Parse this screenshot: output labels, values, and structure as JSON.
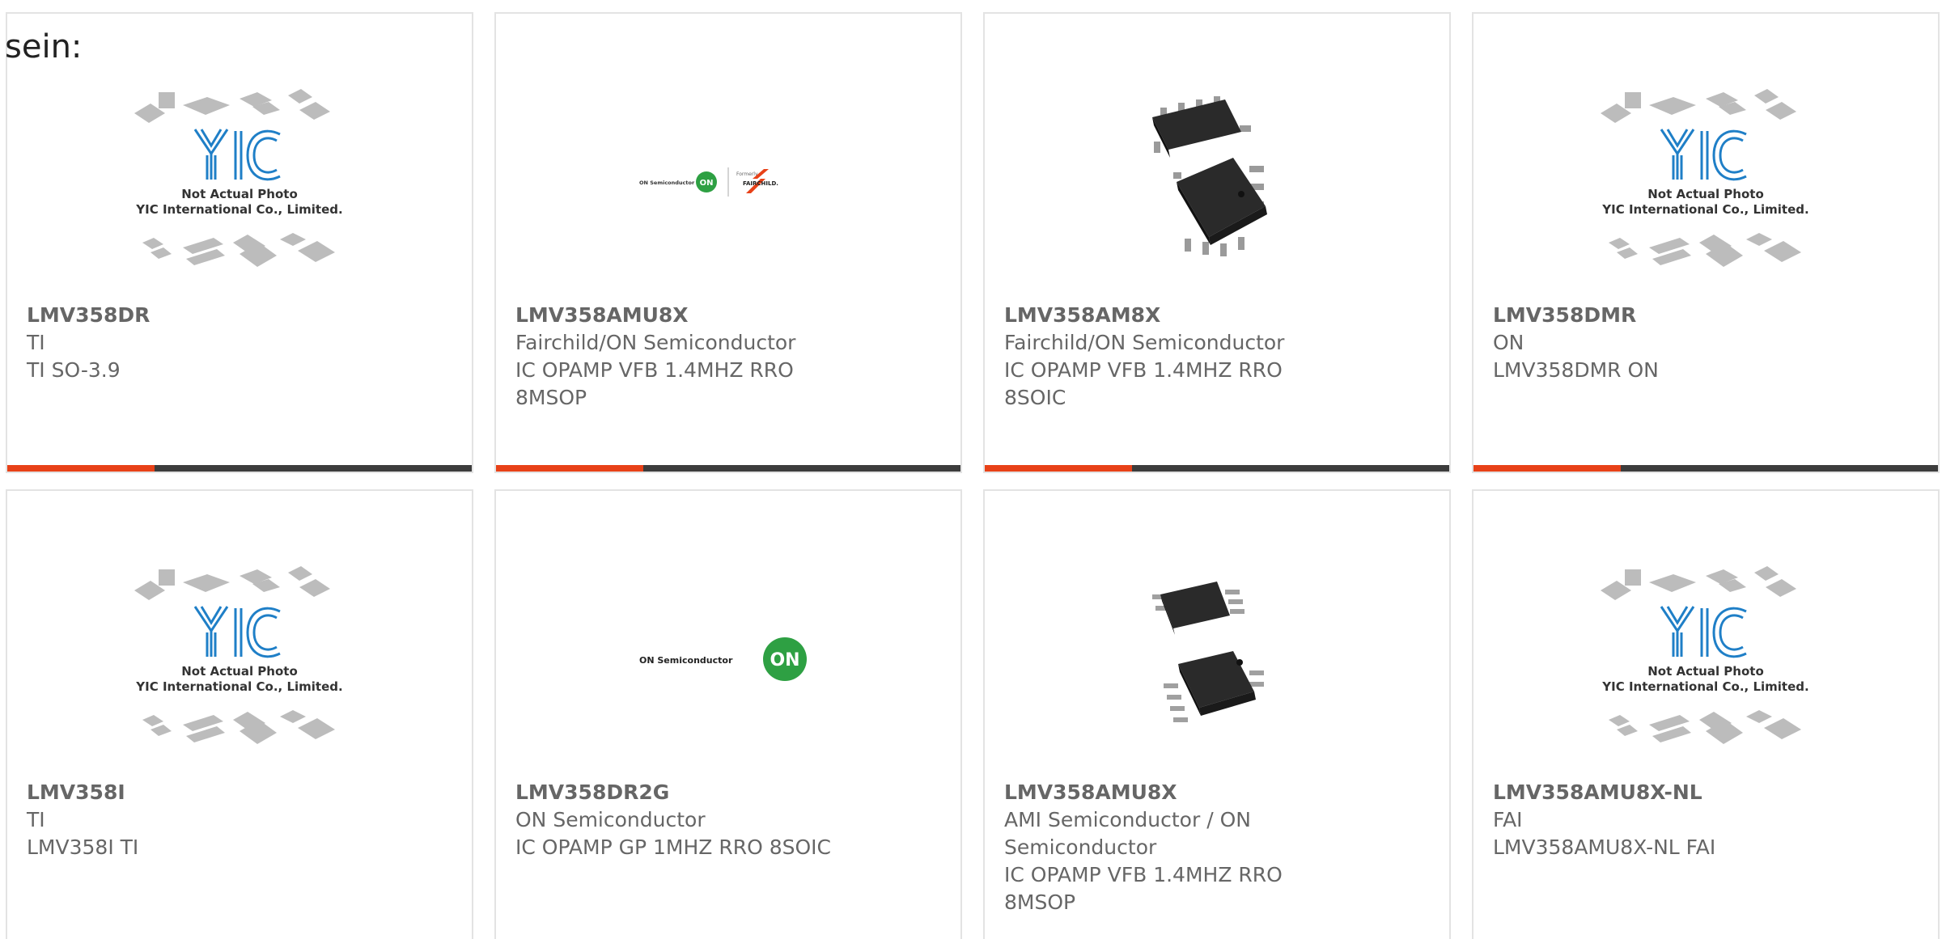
{
  "intro": "sein:",
  "placeholder": {
    "line1": "Not Actual Photo",
    "line2": "YIC International Co., Limited."
  },
  "logos": {
    "on_semi_text": "ON Semiconductor",
    "on_badge": "ON",
    "formerly": "Formerly",
    "fairchild": "FAIRCHILD."
  },
  "colors": {
    "accent": "#e84118",
    "bar": "#3c3c3c",
    "text": "#666666",
    "on_green": "#2ea043",
    "yic_blue": "#1f7fc7"
  },
  "products": [
    {
      "part": "LMV358DR",
      "manufacturer": "TI",
      "description": "TI SO-3.9",
      "image": "yic-placeholder"
    },
    {
      "part": "LMV358AMU8X",
      "manufacturer": "Fairchild/ON Semiconductor",
      "description": "IC OPAMP VFB 1.4MHZ RRO 8MSOP",
      "image": "on-fairchild-logo"
    },
    {
      "part": "LMV358AM8X",
      "manufacturer": "Fairchild/ON Semiconductor",
      "description": "IC OPAMP VFB 1.4MHZ RRO 8SOIC",
      "image": "soic-chip"
    },
    {
      "part": "LMV358DMR",
      "manufacturer": "ON",
      "description": "LMV358DMR ON",
      "image": "yic-placeholder"
    },
    {
      "part": "LMV358I",
      "manufacturer": "TI",
      "description": "LMV358I TI",
      "image": "yic-placeholder"
    },
    {
      "part": "LMV358DR2G",
      "manufacturer": "ON Semiconductor",
      "description": "IC OPAMP GP 1MHZ RRO 8SOIC",
      "image": "on-semi-logo"
    },
    {
      "part": "LMV358AMU8X",
      "manufacturer": "AMI Semiconductor / ON Semiconductor",
      "description": "IC OPAMP VFB 1.4MHZ RRO 8MSOP",
      "image": "msop-chip"
    },
    {
      "part": "LMV358AMU8X-NL",
      "manufacturer": "FAI",
      "description": "LMV358AMU8X-NL FAI",
      "image": "yic-placeholder"
    }
  ]
}
